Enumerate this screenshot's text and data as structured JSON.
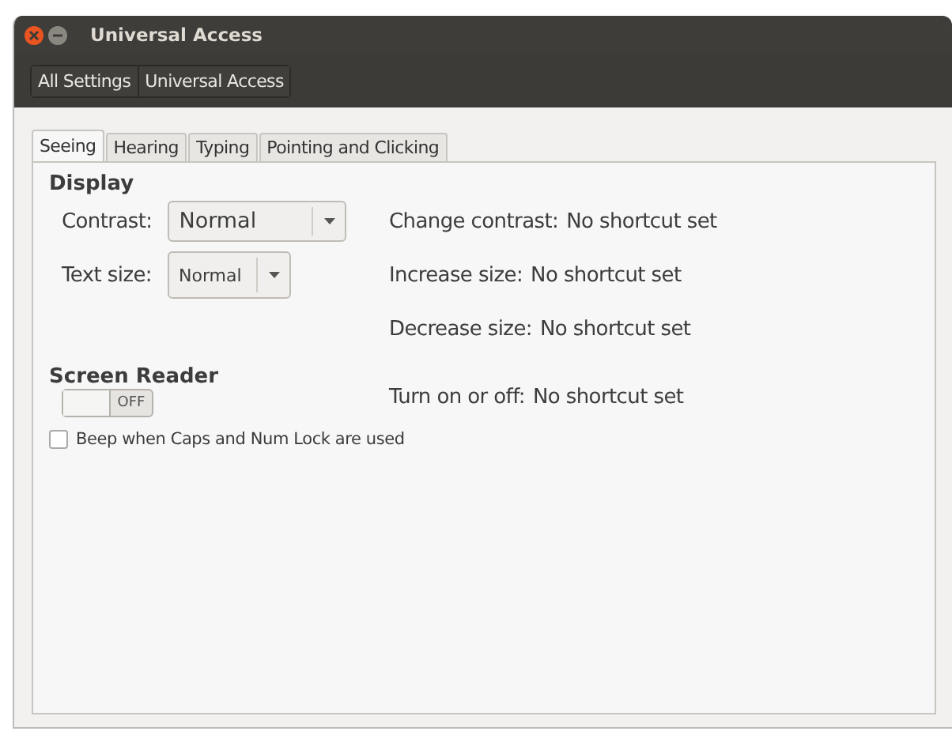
{
  "window": {
    "title": "Universal Access"
  },
  "breadcrumbs": [
    {
      "label": "All Settings"
    },
    {
      "label": "Universal Access"
    }
  ],
  "tabs": [
    {
      "label": "Seeing",
      "selected": true
    },
    {
      "label": "Hearing",
      "selected": false
    },
    {
      "label": "Typing",
      "selected": false
    },
    {
      "label": "Pointing and Clicking",
      "selected": false
    }
  ],
  "display": {
    "heading": "Display",
    "rows": [
      {
        "label": "Contrast:",
        "value": "Normal",
        "kind": "large",
        "shortcut_label": "Change contrast:",
        "shortcut": "No shortcut set"
      },
      {
        "label": "Text size:",
        "value": "Normal",
        "kind": "small",
        "shortcut_label": "Increase size:",
        "shortcut": "No shortcut set"
      },
      {
        "shortcut_label": "Decrease size:",
        "shortcut": "No shortcut set"
      }
    ]
  },
  "screen_reader": {
    "heading": "Screen Reader",
    "switch_label": "OFF",
    "on": false,
    "shortcut_label": "Turn on or off:",
    "shortcut": "No shortcut set"
  },
  "beep": {
    "label": "Beep when Caps and Num Lock are used",
    "checked": false
  }
}
